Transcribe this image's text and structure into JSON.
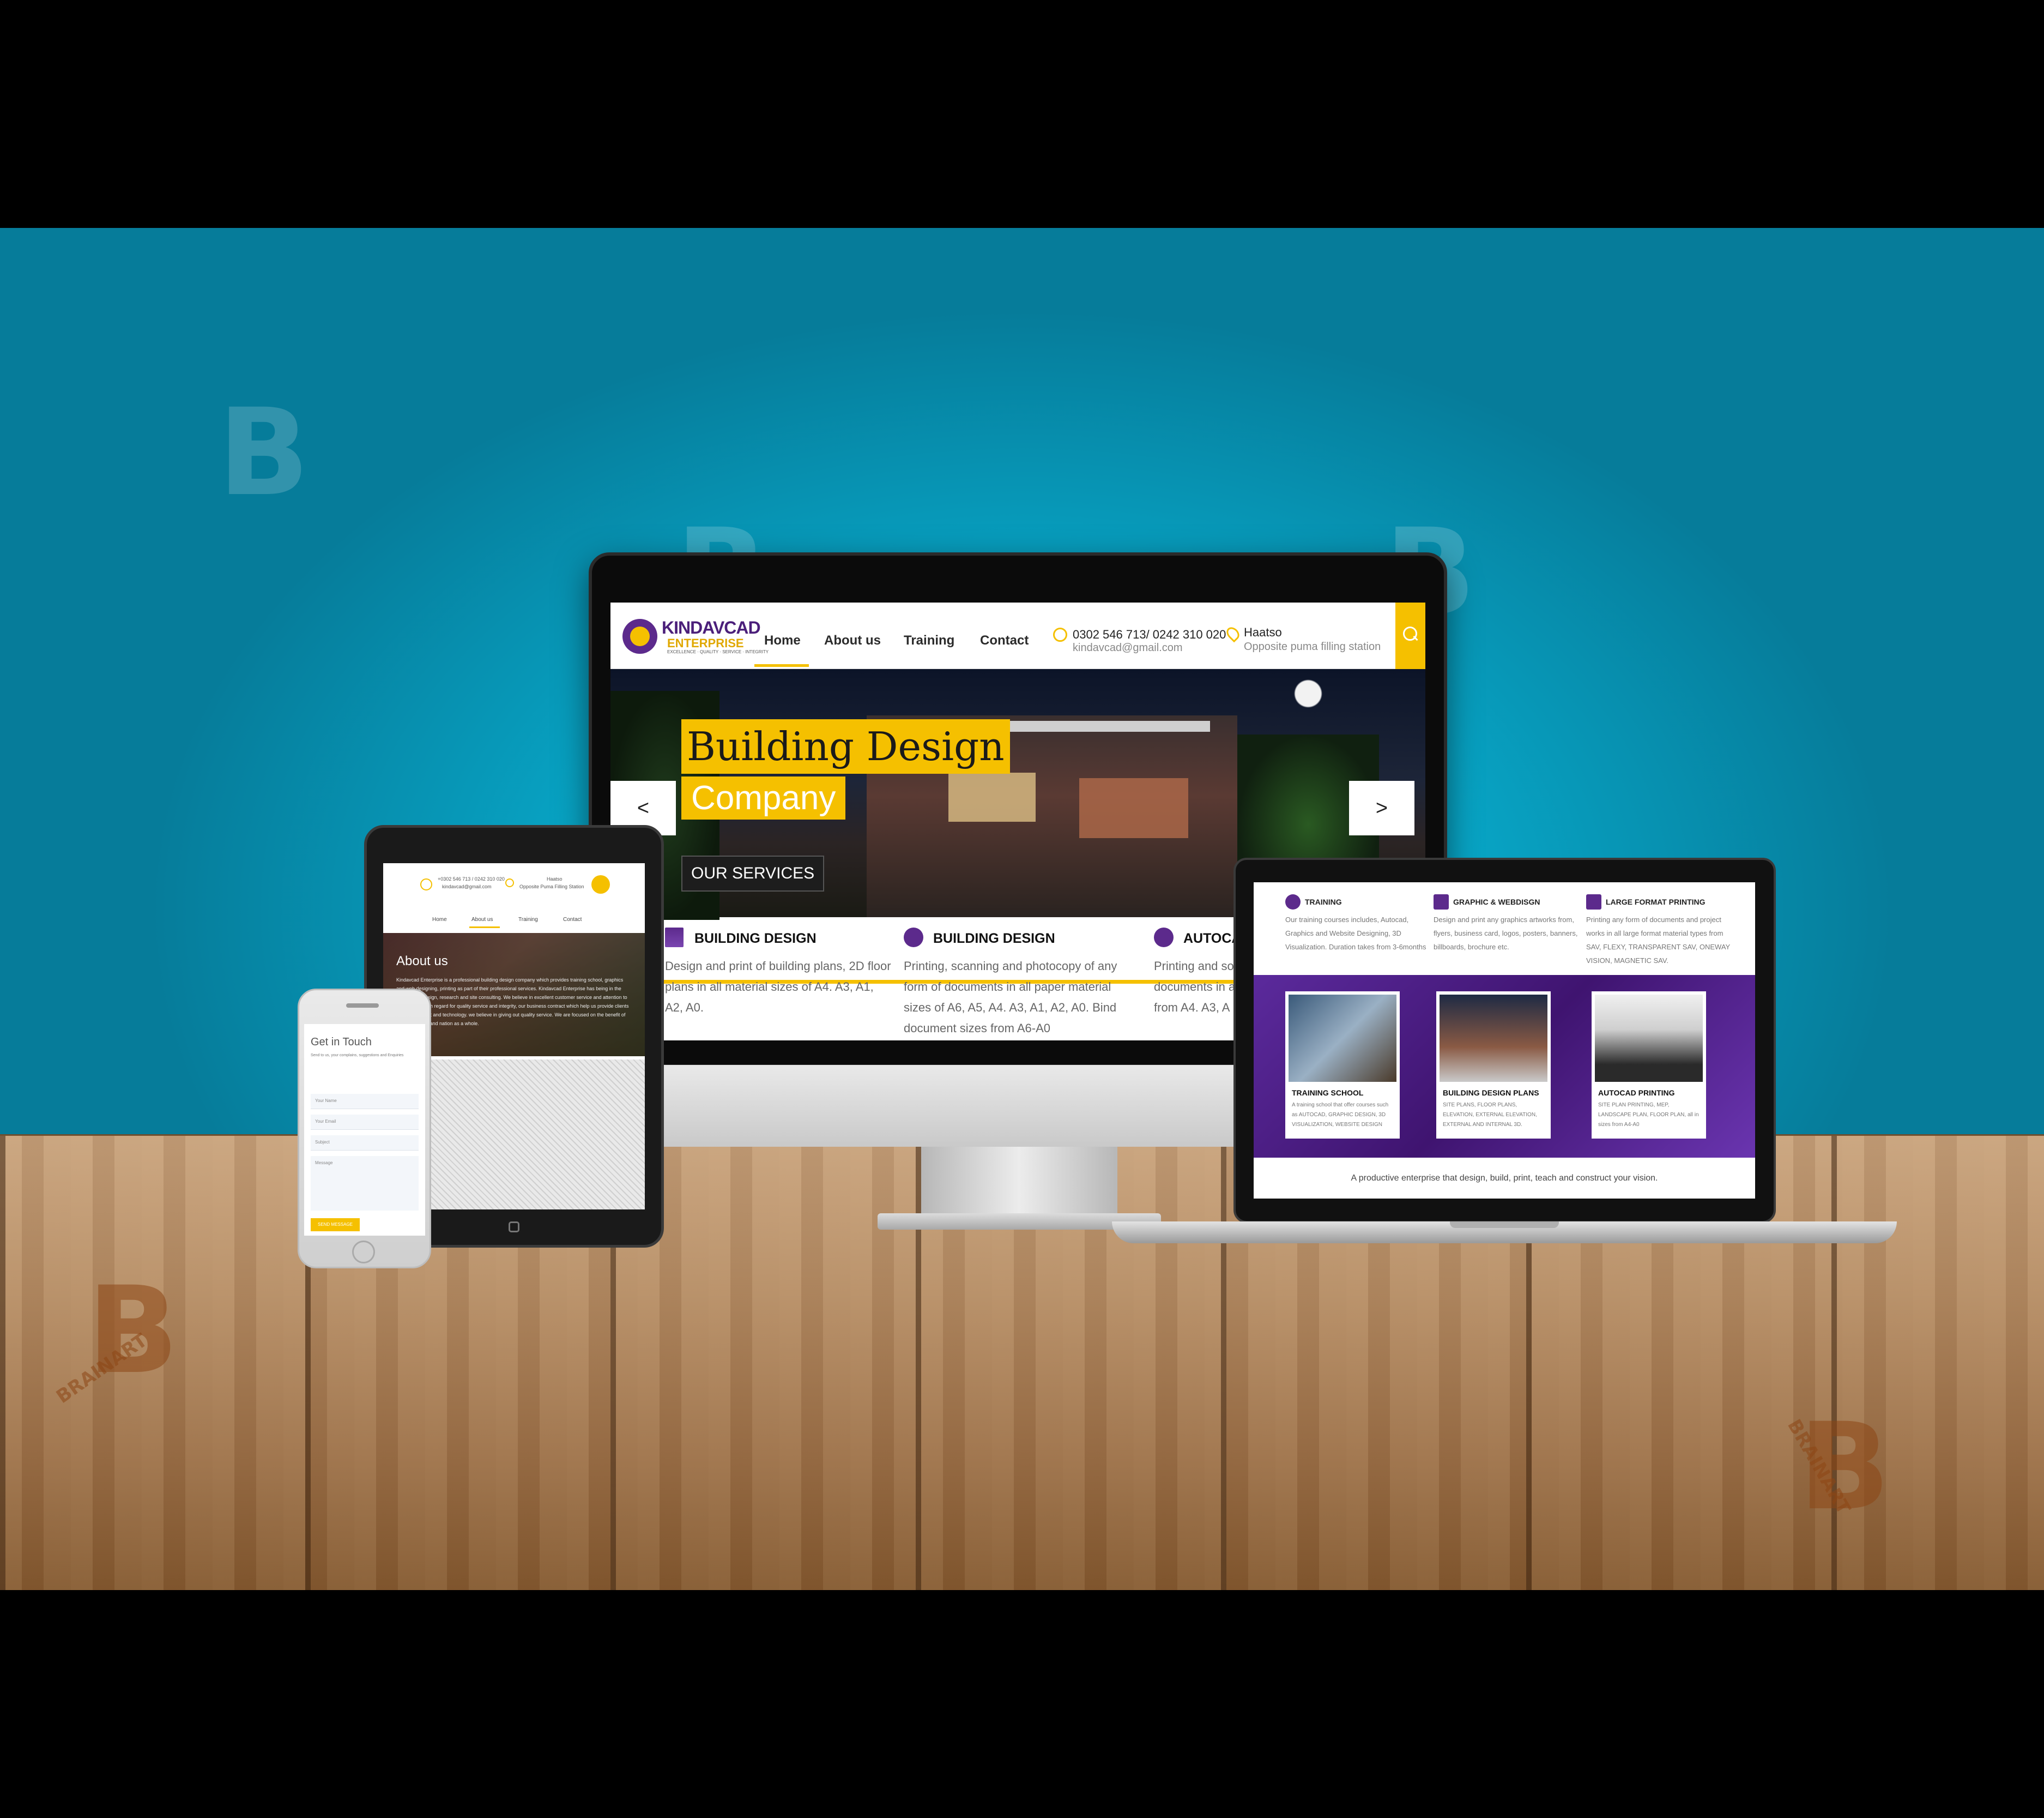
{
  "scene": {
    "watermark_brand": "BRAINART",
    "watermark_letter": "B"
  },
  "desktop": {
    "logo": {
      "name": "KINDAVCAD",
      "sub": "ENTERPRISE",
      "tagline": "EXCELLENCE · QUALITY · SERVICE · INTEGRITY"
    },
    "nav": [
      "Home",
      "About us",
      "Training",
      "Contact"
    ],
    "contact": {
      "phone": "0302 546 713/ 0242 310 020",
      "email": "kindavcad@gmail.com",
      "location": "Haatso",
      "location_detail": "Opposite puma filling station"
    },
    "hero": {
      "title_line1": "Building Design",
      "title_line2": "Company",
      "button": "OUR SERVICES",
      "prev": "<",
      "next": ">"
    },
    "services": [
      {
        "title": "BUILDING DESIGN",
        "body": "Design and print of building plans, 2D floor plans in  all material sizes of A4. A3, A1, A2, A0."
      },
      {
        "title": "BUILDING DESIGN",
        "body": "Printing, scanning and photocopy of any form of documents in all paper material sizes of  A6, A5, A4. A3, A1, A2, A0.  Bind document sizes from A6-A0"
      },
      {
        "title": "AUTOCA",
        "body": "Printing and so documents in a from  A4. A3, A"
      }
    ]
  },
  "laptop": {
    "columns": [
      {
        "title": "TRAINING",
        "body": "Our training courses includes, Autocad, Graphics and Website Designing, 3D Visualization. Duration takes from 3-6months"
      },
      {
        "title": "GRAPHIC & WEBDISGN",
        "body": "Design and print any graphics artworks from, flyers, business card, logos, posters, banners, billboards, brochure etc."
      },
      {
        "title": "LARGE FORMAT PRINTING",
        "body": "Printing any form of documents and project works in all large format material types from SAV, FLEXY, TRANSPARENT SAV, ONEWAY VISION, MAGNETIC SAV."
      }
    ],
    "cards": [
      {
        "title": "TRAINING SCHOOL",
        "body": "A training school that offer courses such as AUTOCAD, GRAPHIC DESIGN, 3D VISUALIZATION, WEBSITE DESIGN"
      },
      {
        "title": "BUILDING DESIGN PLANS",
        "body": "SITE PLANS, FLOOR PLANS, ELEVATION, EXTERNAL ELEVATION, EXTERNAL AND INTERNAL 3D."
      },
      {
        "title": "AUTOCAD PRINTING",
        "body": "SITE PLAN PRINTING, MEP, LANDSCAPE PLAN, FLOOR PLAN, all in sizes from A4-A0"
      }
    ],
    "footer": "A productive enterprise that design, build, print, teach and construct your vision."
  },
  "tablet": {
    "contact_phone": "+0302 546 713 / 0242 310 020",
    "contact_email": "kindavcad@gmail.com",
    "location": "Haatso",
    "location_detail": "Opposite Puma Filling Station",
    "nav": [
      "Home",
      "About us",
      "Training",
      "Contact"
    ],
    "about_title": "About us",
    "about_text": "Kindavcad Enterprise is a professional building design company which provides training school, graphics and web designing, printing as part of their professional services. Kindavcad Enterprise has being in the business of design, research and site consulting. We believe in excellent customer service and attention to detail with a high regard for quality service and integrity, our business contract which help us provide clients with skills, talent and technology. we believe in giving out quality service. We are focused on the benefit of our community and nation as a whole."
  },
  "phone": {
    "title": "Get in Touch",
    "subtitle": "Send to us, your complains, suggestions and Enquiries",
    "fields": [
      "Your Name",
      "Your Email",
      "Subject"
    ],
    "message": "Message",
    "send": "SEND MESSAGE"
  },
  "colors": {
    "accent": "#f5c000",
    "brand_purple": "#5c2a8c",
    "wall": "#08aacb"
  }
}
